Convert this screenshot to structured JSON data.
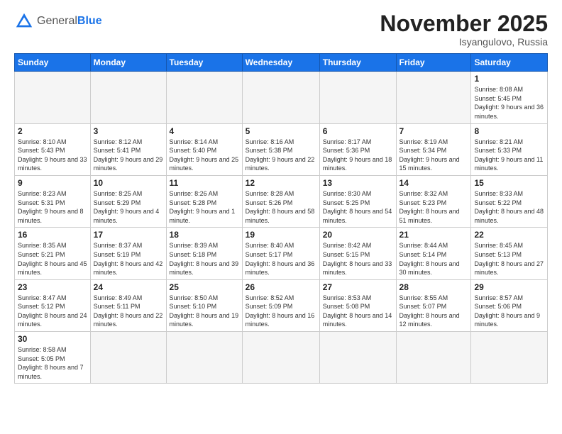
{
  "logo": {
    "general": "General",
    "blue": "Blue"
  },
  "header": {
    "month": "November 2025",
    "location": "Isyangulovo, Russia"
  },
  "weekdays": [
    "Sunday",
    "Monday",
    "Tuesday",
    "Wednesday",
    "Thursday",
    "Friday",
    "Saturday"
  ],
  "weeks": [
    [
      {
        "day": "",
        "info": ""
      },
      {
        "day": "",
        "info": ""
      },
      {
        "day": "",
        "info": ""
      },
      {
        "day": "",
        "info": ""
      },
      {
        "day": "",
        "info": ""
      },
      {
        "day": "",
        "info": ""
      },
      {
        "day": "1",
        "info": "Sunrise: 8:08 AM\nSunset: 5:45 PM\nDaylight: 9 hours and 36 minutes."
      }
    ],
    [
      {
        "day": "2",
        "info": "Sunrise: 8:10 AM\nSunset: 5:43 PM\nDaylight: 9 hours and 33 minutes."
      },
      {
        "day": "3",
        "info": "Sunrise: 8:12 AM\nSunset: 5:41 PM\nDaylight: 9 hours and 29 minutes."
      },
      {
        "day": "4",
        "info": "Sunrise: 8:14 AM\nSunset: 5:40 PM\nDaylight: 9 hours and 25 minutes."
      },
      {
        "day": "5",
        "info": "Sunrise: 8:16 AM\nSunset: 5:38 PM\nDaylight: 9 hours and 22 minutes."
      },
      {
        "day": "6",
        "info": "Sunrise: 8:17 AM\nSunset: 5:36 PM\nDaylight: 9 hours and 18 minutes."
      },
      {
        "day": "7",
        "info": "Sunrise: 8:19 AM\nSunset: 5:34 PM\nDaylight: 9 hours and 15 minutes."
      },
      {
        "day": "8",
        "info": "Sunrise: 8:21 AM\nSunset: 5:33 PM\nDaylight: 9 hours and 11 minutes."
      }
    ],
    [
      {
        "day": "9",
        "info": "Sunrise: 8:23 AM\nSunset: 5:31 PM\nDaylight: 9 hours and 8 minutes."
      },
      {
        "day": "10",
        "info": "Sunrise: 8:25 AM\nSunset: 5:29 PM\nDaylight: 9 hours and 4 minutes."
      },
      {
        "day": "11",
        "info": "Sunrise: 8:26 AM\nSunset: 5:28 PM\nDaylight: 9 hours and 1 minute."
      },
      {
        "day": "12",
        "info": "Sunrise: 8:28 AM\nSunset: 5:26 PM\nDaylight: 8 hours and 58 minutes."
      },
      {
        "day": "13",
        "info": "Sunrise: 8:30 AM\nSunset: 5:25 PM\nDaylight: 8 hours and 54 minutes."
      },
      {
        "day": "14",
        "info": "Sunrise: 8:32 AM\nSunset: 5:23 PM\nDaylight: 8 hours and 51 minutes."
      },
      {
        "day": "15",
        "info": "Sunrise: 8:33 AM\nSunset: 5:22 PM\nDaylight: 8 hours and 48 minutes."
      }
    ],
    [
      {
        "day": "16",
        "info": "Sunrise: 8:35 AM\nSunset: 5:21 PM\nDaylight: 8 hours and 45 minutes."
      },
      {
        "day": "17",
        "info": "Sunrise: 8:37 AM\nSunset: 5:19 PM\nDaylight: 8 hours and 42 minutes."
      },
      {
        "day": "18",
        "info": "Sunrise: 8:39 AM\nSunset: 5:18 PM\nDaylight: 8 hours and 39 minutes."
      },
      {
        "day": "19",
        "info": "Sunrise: 8:40 AM\nSunset: 5:17 PM\nDaylight: 8 hours and 36 minutes."
      },
      {
        "day": "20",
        "info": "Sunrise: 8:42 AM\nSunset: 5:15 PM\nDaylight: 8 hours and 33 minutes."
      },
      {
        "day": "21",
        "info": "Sunrise: 8:44 AM\nSunset: 5:14 PM\nDaylight: 8 hours and 30 minutes."
      },
      {
        "day": "22",
        "info": "Sunrise: 8:45 AM\nSunset: 5:13 PM\nDaylight: 8 hours and 27 minutes."
      }
    ],
    [
      {
        "day": "23",
        "info": "Sunrise: 8:47 AM\nSunset: 5:12 PM\nDaylight: 8 hours and 24 minutes."
      },
      {
        "day": "24",
        "info": "Sunrise: 8:49 AM\nSunset: 5:11 PM\nDaylight: 8 hours and 22 minutes."
      },
      {
        "day": "25",
        "info": "Sunrise: 8:50 AM\nSunset: 5:10 PM\nDaylight: 8 hours and 19 minutes."
      },
      {
        "day": "26",
        "info": "Sunrise: 8:52 AM\nSunset: 5:09 PM\nDaylight: 8 hours and 16 minutes."
      },
      {
        "day": "27",
        "info": "Sunrise: 8:53 AM\nSunset: 5:08 PM\nDaylight: 8 hours and 14 minutes."
      },
      {
        "day": "28",
        "info": "Sunrise: 8:55 AM\nSunset: 5:07 PM\nDaylight: 8 hours and 12 minutes."
      },
      {
        "day": "29",
        "info": "Sunrise: 8:57 AM\nSunset: 5:06 PM\nDaylight: 8 hours and 9 minutes."
      }
    ],
    [
      {
        "day": "30",
        "info": "Sunrise: 8:58 AM\nSunset: 5:05 PM\nDaylight: 8 hours and 7 minutes."
      },
      {
        "day": "",
        "info": ""
      },
      {
        "day": "",
        "info": ""
      },
      {
        "day": "",
        "info": ""
      },
      {
        "day": "",
        "info": ""
      },
      {
        "day": "",
        "info": ""
      },
      {
        "day": "",
        "info": ""
      }
    ]
  ]
}
